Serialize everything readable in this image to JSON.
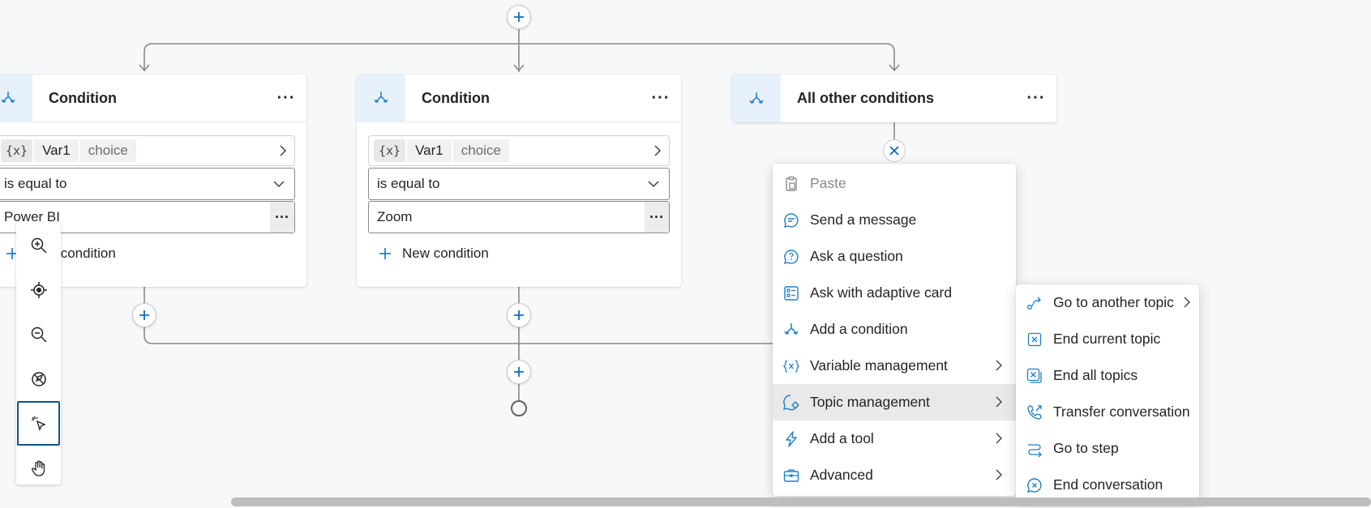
{
  "canvas": {
    "branches": [
      {
        "title": "Condition",
        "more": "···",
        "var_token": "{x}",
        "var_name": "Var1",
        "var_field": "choice",
        "operator": "is equal to",
        "value": "Power BI",
        "value_more": "···",
        "new_condition": "New condition"
      },
      {
        "title": "Condition",
        "more": "···",
        "var_token": "{x}",
        "var_name": "Var1",
        "var_field": "choice",
        "operator": "is equal to",
        "value": "Zoom",
        "value_more": "···",
        "new_condition": "New condition"
      },
      {
        "title": "All other conditions",
        "more": "···"
      }
    ]
  },
  "toolbar": {
    "tools": [
      "zoom-in-icon",
      "recenter-icon",
      "zoom-out-icon",
      "minimap-off-icon",
      "select-pointer-icon",
      "pan-hand-icon"
    ],
    "active": "select-pointer-icon"
  },
  "add_node_menu": {
    "items": [
      {
        "label": "Paste",
        "icon": "paste-icon",
        "disabled": true
      },
      {
        "label": "Send a message",
        "icon": "message-icon"
      },
      {
        "label": "Ask a question",
        "icon": "question-icon"
      },
      {
        "label": "Ask with adaptive card",
        "icon": "adaptive-card-icon"
      },
      {
        "label": "Add a condition",
        "icon": "condition-icon"
      },
      {
        "label": "Variable management",
        "icon": "variable-icon",
        "submenu": true
      },
      {
        "label": "Topic management",
        "icon": "topic-icon",
        "submenu": true,
        "selected": true
      },
      {
        "label": "Add a tool",
        "icon": "tool-icon",
        "submenu": true
      },
      {
        "label": "Advanced",
        "icon": "briefcase-icon",
        "submenu": true
      }
    ]
  },
  "topic_submenu": {
    "items": [
      {
        "label": "Go to another topic",
        "icon": "redirect-icon",
        "submenu": true
      },
      {
        "label": "End current topic",
        "icon": "end-topic-icon"
      },
      {
        "label": "End all topics",
        "icon": "end-all-icon"
      },
      {
        "label": "Transfer conversation",
        "icon": "transfer-icon"
      },
      {
        "label": "Go to step",
        "icon": "goto-step-icon"
      },
      {
        "label": "End conversation",
        "icon": "end-conversation-icon"
      }
    ]
  },
  "colors": {
    "accent": "#0f6cbd",
    "icon_blue": "#1e7ec8",
    "canvas_bg": "#f7f8fa",
    "line": "#8a8a8a"
  }
}
